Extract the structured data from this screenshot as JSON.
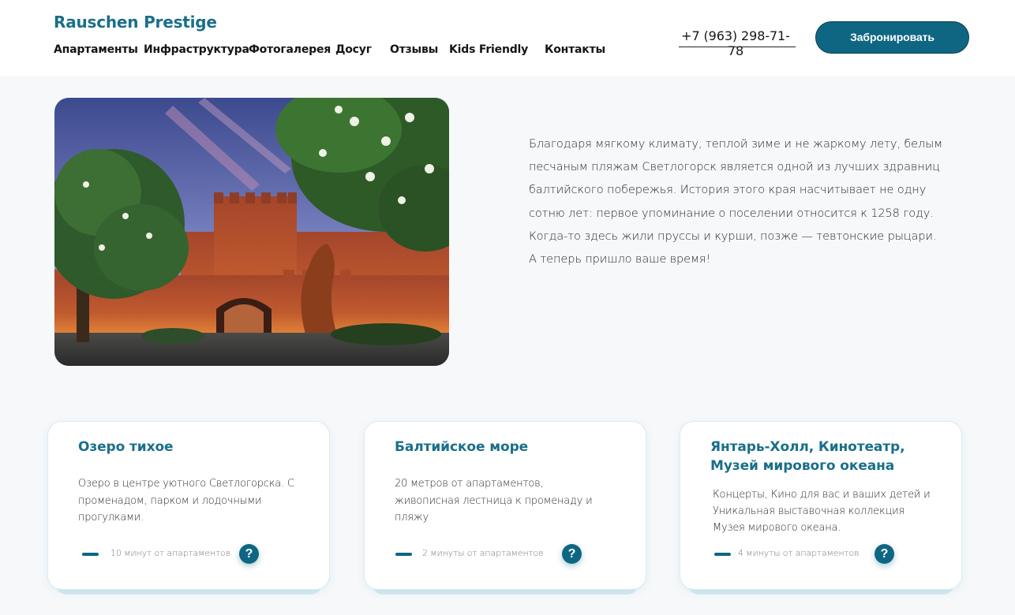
{
  "header": {
    "logo": "Rauschen Prestige",
    "nav": [
      {
        "label": "Апартаменты"
      },
      {
        "label": "Инфраструктура"
      },
      {
        "label": "Фотогалерея"
      },
      {
        "label": "Досуг"
      },
      {
        "label": "Отзывы"
      },
      {
        "label": "Kids Friendly"
      },
      {
        "label": "Контакты"
      }
    ],
    "phone": "+7 (963) 298-71-78",
    "book_label": "Забронировать"
  },
  "colors": {
    "brand": "#1a6f8a",
    "button": "#0e6683",
    "page_bg": "#f6f8fa"
  },
  "hero": {
    "photo_icon": "castle-photo",
    "intro_lines": [
      "Благодаря мягкому климату, теплой зиме и не жаркому лету, белым",
      "песчаным пляжам Светлогорск является одной из лучших здравниц",
      "балтийского побережья. История этого края насчитывает не одну",
      "сотню лет: первое упоминание о поселении относится к 1258 году.",
      "Когда-то здесь жили пруссы и курши, позже — тевтонские рыцари.",
      "А теперь пришло ваше время!"
    ]
  },
  "cards": [
    {
      "title": "Озеро тихое",
      "text_lines": [
        "Озеро в центре уютного Светлогорска. С",
        "променадом, парком и лодочными",
        "прогулками."
      ],
      "time": "10 минут от апартаментов",
      "help": "?"
    },
    {
      "title": "Балтийское море",
      "text_lines": [
        "20 метров от апартаментов,",
        "живописная лестница к променаду и",
        "пляжу"
      ],
      "time": "2 минуты от апартаментов",
      "help": "?"
    },
    {
      "title": "Янтарь-Холл, Кинотеатр, Музей мирового океана",
      "text_lines": [
        "Концерты, Кино для вас и ваших детей и",
        "Уникальная выставочная коллекция",
        "Музея мирового океана."
      ],
      "time": "4 минуты от апартаментов",
      "help": "?"
    }
  ]
}
